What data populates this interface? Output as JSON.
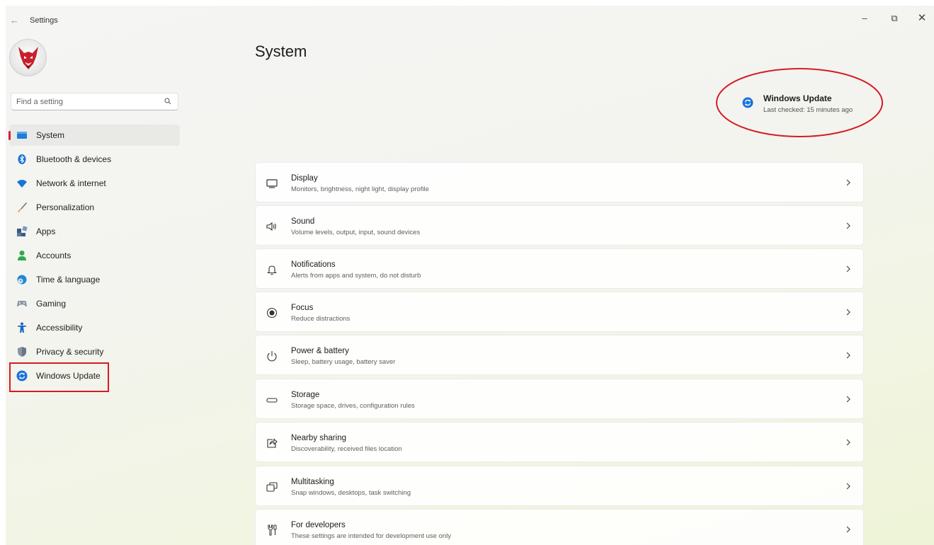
{
  "titlebar": {
    "app_title": "Settings",
    "back_glyph": "←",
    "minimize_glyph": "–",
    "maximize_glyph": "⧉",
    "close_glyph": "✕"
  },
  "search": {
    "placeholder": "Find a setting"
  },
  "sidebar": {
    "items": [
      {
        "label": "System",
        "icon": "system-icon",
        "selected": true
      },
      {
        "label": "Bluetooth & devices",
        "icon": "bluetooth-icon"
      },
      {
        "label": "Network & internet",
        "icon": "wifi-icon"
      },
      {
        "label": "Personalization",
        "icon": "brush-icon"
      },
      {
        "label": "Apps",
        "icon": "apps-icon"
      },
      {
        "label": "Accounts",
        "icon": "person-icon"
      },
      {
        "label": "Time & language",
        "icon": "globe-clock-icon"
      },
      {
        "label": "Gaming",
        "icon": "gamepad-icon"
      },
      {
        "label": "Accessibility",
        "icon": "accessibility-icon"
      },
      {
        "label": "Privacy & security",
        "icon": "shield-icon"
      },
      {
        "label": "Windows Update",
        "icon": "windows-update-icon",
        "highlighted": true
      }
    ]
  },
  "main": {
    "title": "System",
    "windows_update": {
      "title": "Windows Update",
      "subtitle": "Last checked: 15 minutes ago"
    },
    "rows": [
      {
        "title": "Display",
        "subtitle": "Monitors, brightness, night light, display profile",
        "icon": "monitor-icon"
      },
      {
        "title": "Sound",
        "subtitle": "Volume levels, output, input, sound devices",
        "icon": "speaker-icon"
      },
      {
        "title": "Notifications",
        "subtitle": "Alerts from apps and system, do not disturb",
        "icon": "bell-icon"
      },
      {
        "title": "Focus",
        "subtitle": "Reduce distractions",
        "icon": "focus-icon"
      },
      {
        "title": "Power & battery",
        "subtitle": "Sleep, battery usage, battery saver",
        "icon": "power-icon"
      },
      {
        "title": "Storage",
        "subtitle": "Storage space, drives, configuration rules",
        "icon": "storage-icon"
      },
      {
        "title": "Nearby sharing",
        "subtitle": "Discoverability, received files location",
        "icon": "share-icon"
      },
      {
        "title": "Multitasking",
        "subtitle": "Snap windows, desktops, task switching",
        "icon": "multitasking-icon"
      },
      {
        "title": "For developers",
        "subtitle": "These settings are intended for development use only",
        "icon": "developer-tools-icon"
      }
    ]
  },
  "colors": {
    "accent_red": "#d61b24",
    "update_blue": "#1a73d9",
    "selected_indicator": "#d0242a"
  }
}
